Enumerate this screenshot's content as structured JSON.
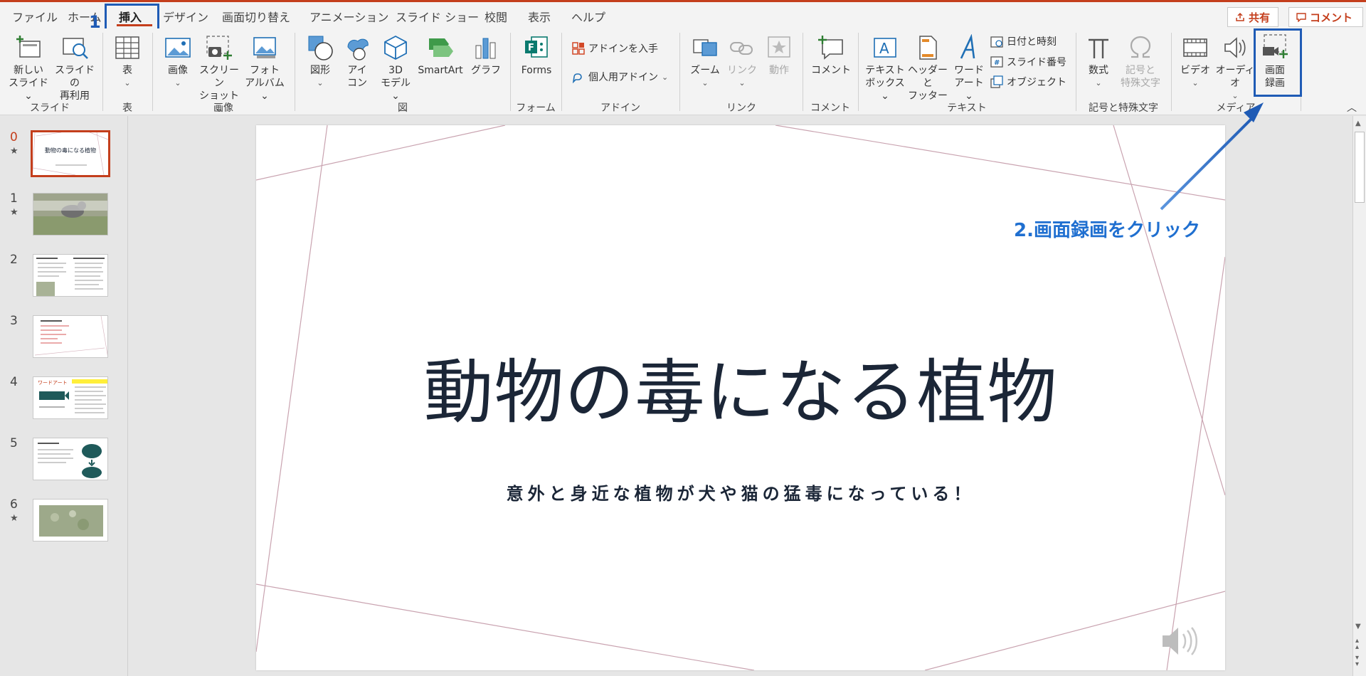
{
  "tabs": [
    "ファイル",
    "ホーム",
    "挿入",
    "デザイン",
    "画面切り替え",
    "アニメーション",
    "スライド ショー",
    "校閲",
    "表示",
    "ヘルプ"
  ],
  "share_label": "共有",
  "comment_label": "コメント",
  "annotation": {
    "step1": "1",
    "step2": "2.画面録画をクリック"
  },
  "ribbon": {
    "new_slide": [
      "新しい",
      "スライド ⌄"
    ],
    "reuse_slide": [
      "スライドの",
      "再利用"
    ],
    "table": "表",
    "image": "画像",
    "screenshot": [
      "スクリーン",
      "ショット ⌄"
    ],
    "photo_album": [
      "フォト",
      "アルバム ⌄"
    ],
    "shapes": "図形",
    "icons": [
      "アイ",
      "コン"
    ],
    "model3d": [
      "3D",
      "モデル ⌄"
    ],
    "smartart": "SmartArt",
    "chart": "グラフ",
    "forms": "Forms",
    "get_addins": "アドインを入手",
    "my_addins": "個人用アドイン",
    "zoom": "ズーム",
    "link": "リンク",
    "action": "動作",
    "comment": "コメント",
    "textbox": [
      "テキスト",
      "ボックス ⌄"
    ],
    "header_footer": [
      "ヘッダーと",
      "フッター"
    ],
    "wordart": [
      "ワード",
      "アート ⌄"
    ],
    "datetime": "日付と時刻",
    "slide_number": "スライド番号",
    "object": "オブジェクト",
    "equation": "数式",
    "symbol": [
      "記号と",
      "特殊文字"
    ],
    "video": "ビデオ",
    "audio": "オーディオ",
    "screen_recording": [
      "画面",
      "録画"
    ]
  },
  "groups": {
    "slides": "スライド",
    "table": "表",
    "images": "画像",
    "illustrations": "図",
    "forms": "フォーム",
    "addins": "アドイン",
    "links": "リンク",
    "comments": "コメント",
    "text": "テキスト",
    "symbols": "記号と特殊文字",
    "media": "メディア"
  },
  "thumbnails": [
    {
      "num": "0",
      "star": "★",
      "title": "動物の毒になる植物"
    },
    {
      "num": "1",
      "star": "★"
    },
    {
      "num": "2"
    },
    {
      "num": "3"
    },
    {
      "num": "4",
      "label": "ワードアート"
    },
    {
      "num": "5"
    },
    {
      "num": "6",
      "star": "★"
    }
  ],
  "slide": {
    "title": "動物の毒になる植物",
    "subtitle": "意外と身近な植物が犬や猫の猛毒になっている！"
  },
  "colors": {
    "accent": "#c43e1c",
    "annotation_blue": "#1f5bb5",
    "slide_text": "#1b2637",
    "slide_lines": "#c9a3b0"
  }
}
